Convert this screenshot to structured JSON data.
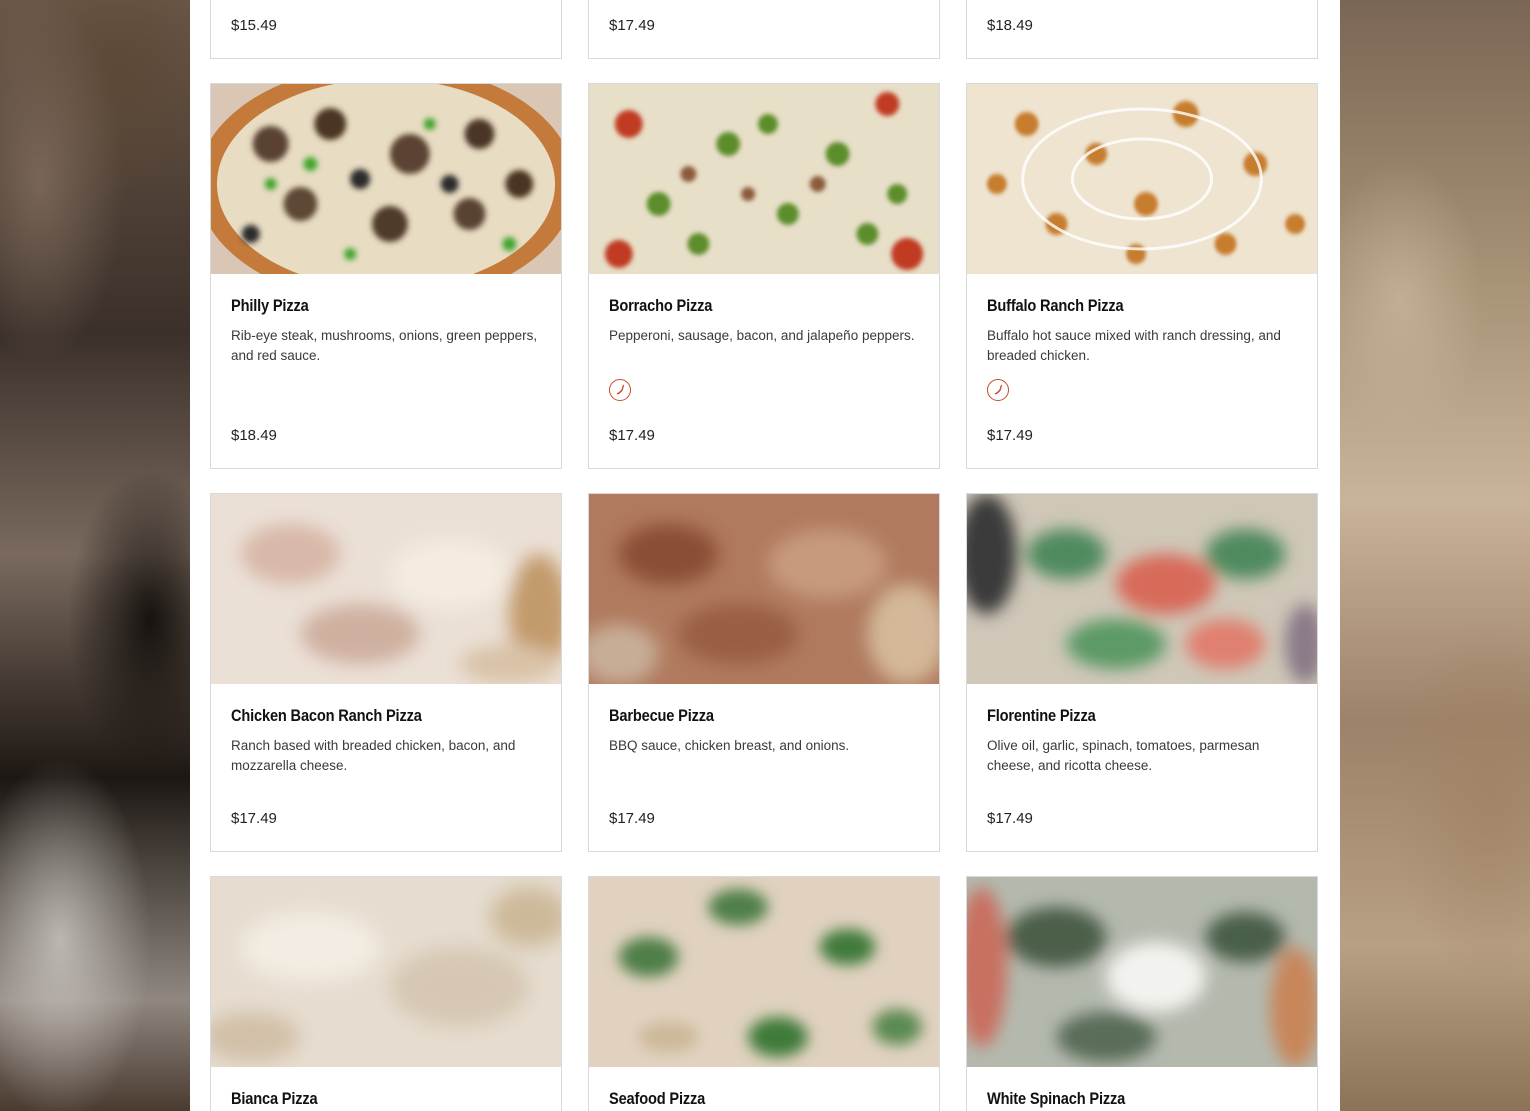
{
  "menu": {
    "top_row_prices": [
      "$15.49",
      "$17.49",
      "$18.49"
    ],
    "items": [
      {
        "name": "Philly Pizza",
        "description": "Rib-eye steak, mushrooms, onions, green peppers, and red sauce.",
        "price": "$18.49",
        "spicy": false
      },
      {
        "name": "Borracho Pizza",
        "description": "Pepperoni, sausage, bacon, and jalapeño peppers.",
        "price": "$17.49",
        "spicy": true
      },
      {
        "name": "Buffalo Ranch Pizza",
        "description": "Buffalo hot sauce mixed with ranch dressing, and breaded chicken.",
        "price": "$17.49",
        "spicy": true
      },
      {
        "name": "Chicken Bacon Ranch Pizza",
        "description": "Ranch based with breaded chicken, bacon, and mozzarella cheese.",
        "price": "$17.49",
        "spicy": false
      },
      {
        "name": "Barbecue Pizza",
        "description": "BBQ sauce, chicken breast, and onions.",
        "price": "$17.49",
        "spicy": false
      },
      {
        "name": "Florentine Pizza",
        "description": "Olive oil, garlic, spinach, tomatoes, parmesan cheese, and ricotta cheese.",
        "price": "$17.49",
        "spicy": false
      },
      {
        "name": "Bianca Pizza",
        "description": "",
        "price": "",
        "spicy": false
      },
      {
        "name": "Seafood Pizza",
        "description": "",
        "price": "",
        "spicy": false
      },
      {
        "name": "White Spinach Pizza",
        "description": "",
        "price": "",
        "spicy": false
      }
    ]
  },
  "colors": {
    "spicy_icon": "#c84a2a",
    "card_border": "#d9d9d9",
    "title_text": "#111111",
    "body_text": "#3a3a3a"
  },
  "icons": {
    "spicy": "chili-pepper-icon"
  }
}
